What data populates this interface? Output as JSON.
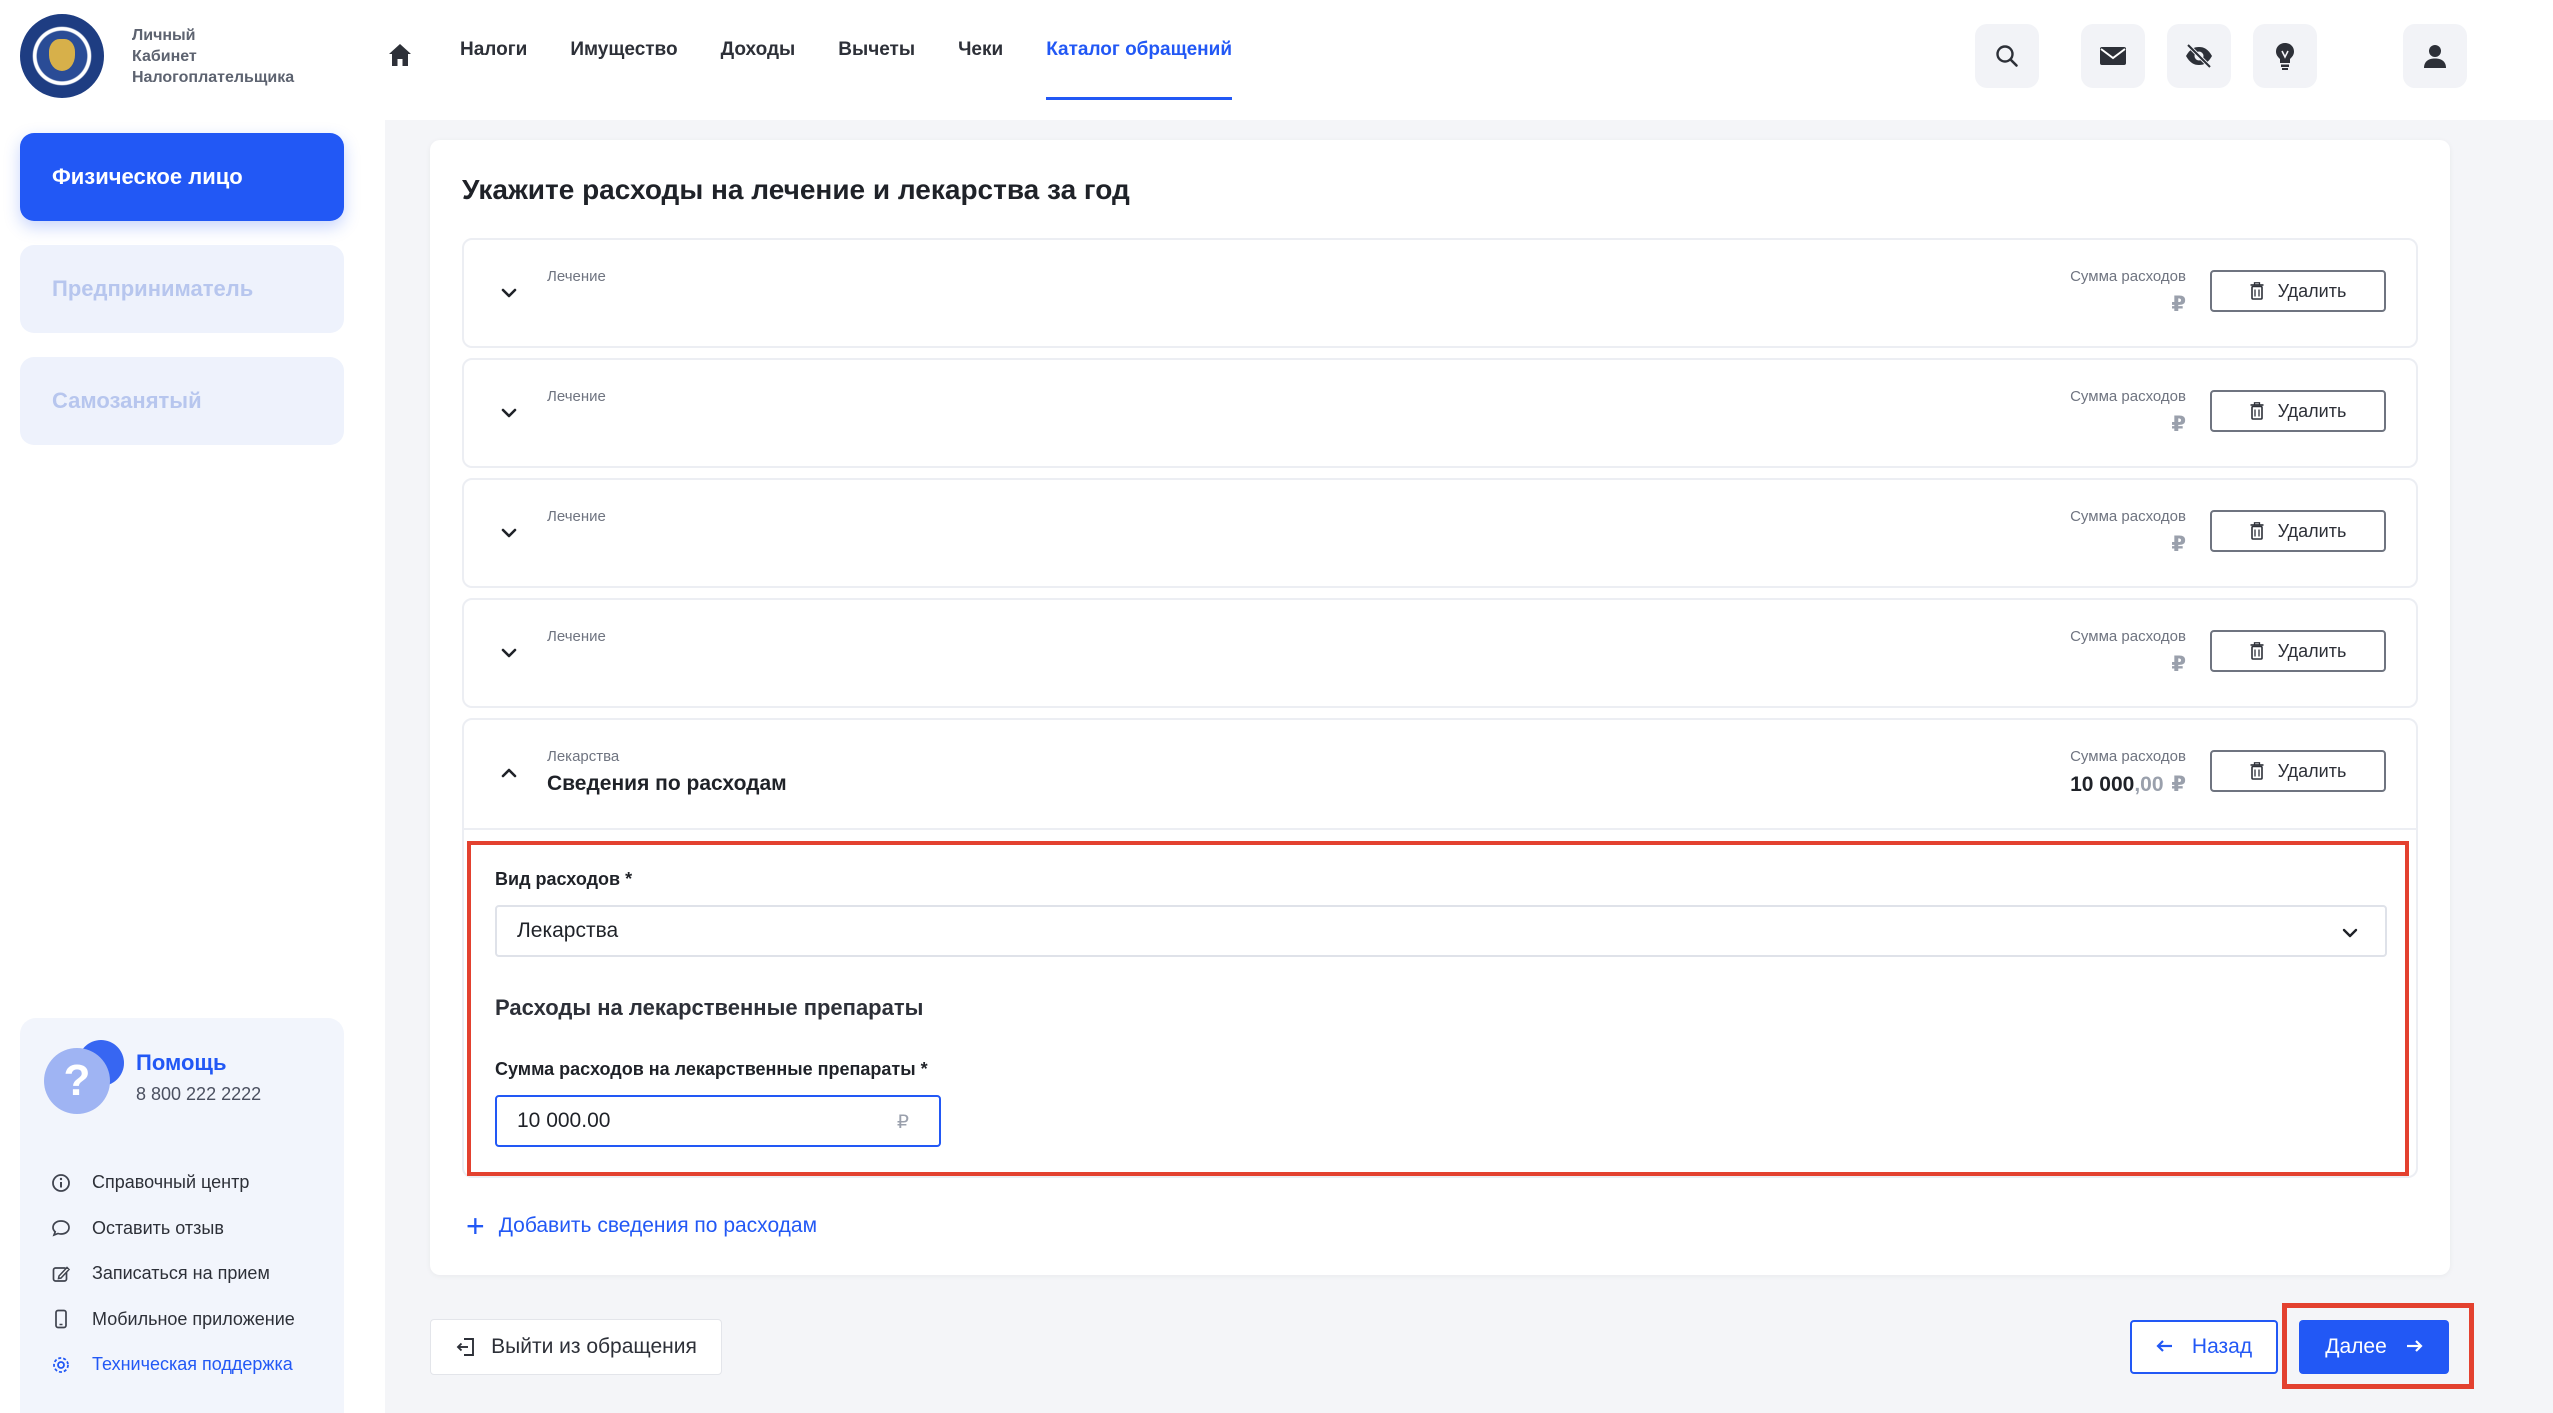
{
  "brand": {
    "line1": "Личный",
    "line2": "Кабинет",
    "line3": "Налогоплательщика"
  },
  "sidebar": {
    "roles": [
      {
        "label": "Физическое лицо",
        "active": true
      },
      {
        "label": "Предприниматель",
        "active": false
      },
      {
        "label": "Самозанятый",
        "active": false
      }
    ],
    "help": {
      "title": "Помощь",
      "phone": "8 800 222 2222",
      "icon_glyph": "?",
      "links": [
        {
          "label": "Справочный центр",
          "icon": "info-icon"
        },
        {
          "label": "Оставить отзыв",
          "icon": "chat-icon"
        },
        {
          "label": "Записаться на прием",
          "icon": "edit-icon"
        },
        {
          "label": "Мобильное приложение",
          "icon": "phone-icon"
        },
        {
          "label": "Техническая поддержка",
          "icon": "gear-icon"
        }
      ]
    }
  },
  "topnav": {
    "items": [
      {
        "label": "Налоги"
      },
      {
        "label": "Имущество"
      },
      {
        "label": "Доходы"
      },
      {
        "label": "Вычеты"
      },
      {
        "label": "Чеки"
      },
      {
        "label": "Каталог обращений",
        "active": true
      }
    ],
    "icons": [
      "search-icon",
      "mail-icon",
      "eye-off-icon",
      "lightbulb-icon",
      "user-icon"
    ]
  },
  "main": {
    "title": "Укажите расходы на лечение и лекарства за год",
    "sum_label": "Сумма расходов",
    "delete_label": "Удалить",
    "currency": "₽",
    "entries": [
      {
        "category": "Лечение",
        "name": "",
        "sum": "",
        "expanded": false
      },
      {
        "category": "Лечение",
        "name": "",
        "sum": "",
        "expanded": false
      },
      {
        "category": "Лечение",
        "name": "",
        "sum": "",
        "expanded": false
      },
      {
        "category": "Лечение",
        "name": "",
        "sum": "",
        "expanded": false
      },
      {
        "category": "Лекарства",
        "name": "Сведения по расходам",
        "sum_int": "10 000",
        "sum_dec": ",00",
        "expanded": true
      }
    ],
    "form": {
      "type_label": "Вид расходов *",
      "type_value": "Лекарства",
      "section_title": "Расходы на лекарственные препараты",
      "amount_label": "Сумма расходов на лекарственные препараты *",
      "amount_value": "10 000.00",
      "amount_currency": "₽"
    },
    "add_label": "Добавить сведения по расходам"
  },
  "footer": {
    "exit_label": "Выйти из обращения",
    "back_label": "Назад",
    "next_label": "Далее"
  },
  "colors": {
    "accent": "#2258f5",
    "highlight": "#e3412f"
  }
}
